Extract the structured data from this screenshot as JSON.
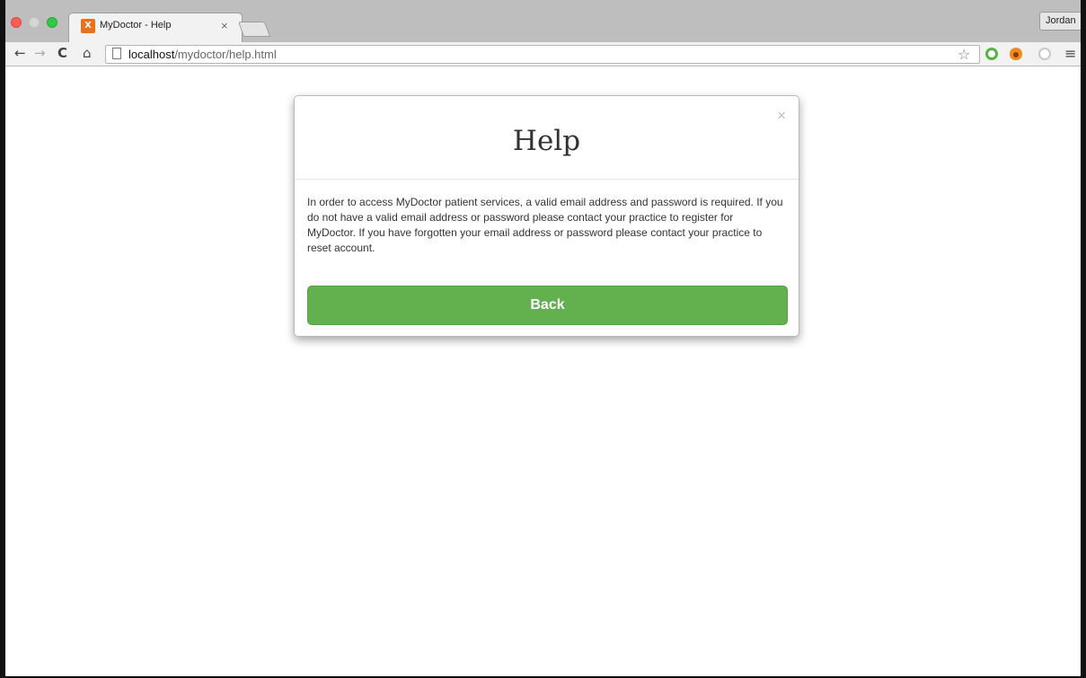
{
  "browser": {
    "tab_title": "MyDoctor - Help",
    "tab_close": "×",
    "tab_favicon": "X",
    "profile_name": "Jordan",
    "url_host": "localhost",
    "url_path": "/mydoctor/help.html",
    "icons": {
      "back": "←",
      "forward": "→",
      "reload": "C",
      "home": "⌂",
      "star": "☆",
      "menu": "≡"
    }
  },
  "modal": {
    "title": "Help",
    "close": "×",
    "body": "In order to access MyDoctor patient services, a valid email address and password is required. If you do not have a valid email address or password please contact your practice to register for MyDoctor. If you have forgotten your email address or password please contact your practice to reset account.",
    "back_label": "Back"
  },
  "colors": {
    "button_green": "#62b04e",
    "title_text": "#333333"
  }
}
